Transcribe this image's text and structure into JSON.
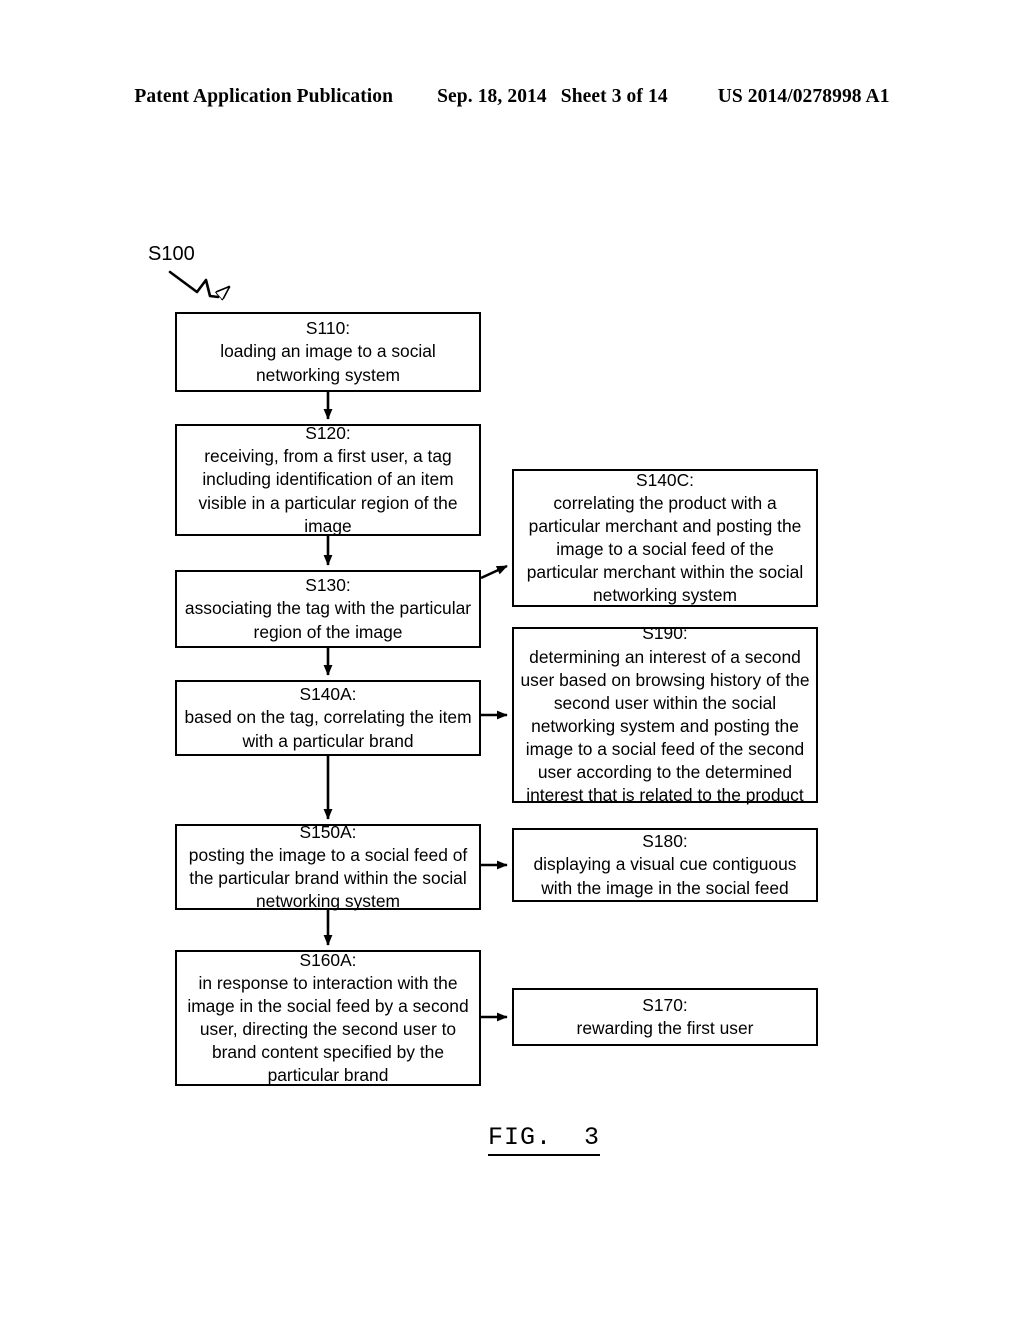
{
  "header": {
    "left": "Patent Application Publication",
    "date": "Sep. 18, 2014",
    "sheet": "Sheet 3 of 14",
    "number": "US 2014/0278998 A1"
  },
  "figure": {
    "reference_label": "S100",
    "caption": "FIG.  3"
  },
  "boxes": {
    "s110": {
      "id": "S110:",
      "text": "loading an image to a social\nnetworking system"
    },
    "s120": {
      "id": "S120:",
      "text": "receiving, from a first user, a tag\nincluding identification of an item\nvisible in a particular region of the\nimage"
    },
    "s130": {
      "id": "S130:",
      "text": "associating the tag with the particular\nregion of the image"
    },
    "s140a": {
      "id": "S140A:",
      "text": "based on the tag, correlating the item\nwith a particular brand"
    },
    "s150a": {
      "id": "S150A:",
      "text": "posting the image to a social feed of\nthe particular brand within the social\nnetworking system"
    },
    "s160a": {
      "id": "S160A:",
      "text": "in response to interaction with the\nimage in the social feed by a second\nuser, directing the second user to\nbrand content specified by the\nparticular brand"
    },
    "s140c": {
      "id": "S140C:",
      "text": "correlating the product with a\nparticular merchant and posting the\nimage to a social feed of the\nparticular merchant within the social\nnetworking system"
    },
    "s190": {
      "id": "S190:",
      "text": "determining an interest of a second\nuser based on browsing history of the\nsecond user within the social\nnetworking system and posting the\nimage to a social feed of the second\nuser according to the determined\ninterest that is related to the product"
    },
    "s180": {
      "id": "S180:",
      "text": "displaying a visual cue contiguous\nwith the image in the social feed"
    },
    "s170": {
      "id": "S170:",
      "text": "rewarding the first user"
    }
  },
  "colors": {
    "ink": "#000000",
    "paper": "#ffffff"
  }
}
